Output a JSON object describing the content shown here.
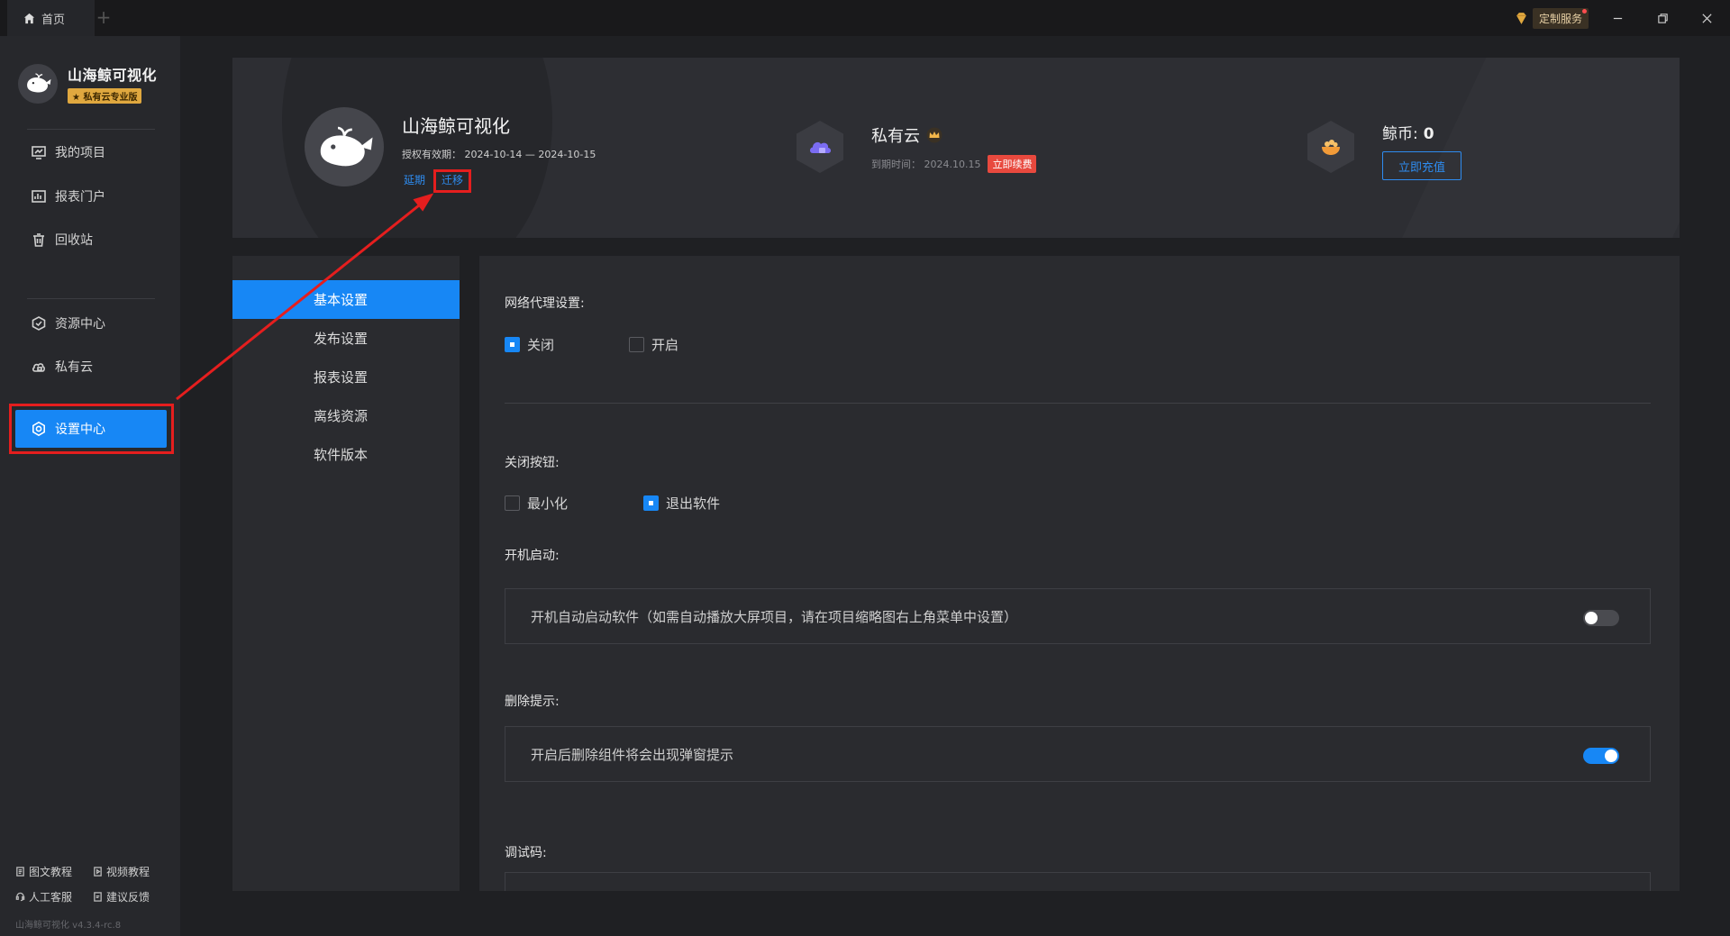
{
  "titlebar": {
    "home_tab": "首页",
    "add_tab": "+",
    "custom_service": "定制服务"
  },
  "sidebar": {
    "brand_name": "山海鲸可视化",
    "brand_badge": "★ 私有云专业版",
    "nav": [
      {
        "label": "我的项目",
        "icon": "project-icon"
      },
      {
        "label": "报表门户",
        "icon": "report-portal-icon"
      },
      {
        "label": "回收站",
        "icon": "trash-icon"
      },
      {
        "label": "资源中心",
        "icon": "resource-icon"
      },
      {
        "label": "私有云",
        "icon": "cloud-icon"
      },
      {
        "label": "设置中心",
        "icon": "gear-icon",
        "active": true
      }
    ],
    "help": [
      "图文教程",
      "视频教程",
      "人工客服",
      "建议反馈"
    ],
    "version": "山海鲸可视化 v4.3.4-rc.8"
  },
  "profile": {
    "name": "山海鲸可视化",
    "valid": "授权有效期： 2024-10-14 — 2024-10-15",
    "extend_link": "延期",
    "move_link": "迁移",
    "private_cloud_title": "私有云",
    "expire_text": "到期时间：  2024.10.15",
    "renew_button": "立即续费",
    "coin_label": "鲸币:",
    "coin_value": "0",
    "recharge_button": "立即充值"
  },
  "settings_menu": [
    "基本设置",
    "发布设置",
    "报表设置",
    "离线资源",
    "软件版本"
  ],
  "settings": {
    "proxy_label": "网络代理设置:",
    "proxy_off": "关闭",
    "proxy_on": "开启",
    "proxy_selected": "关闭",
    "close_label": "关闭按钮:",
    "close_minimize": "最小化",
    "close_exit": "退出软件",
    "close_selected": "退出软件",
    "startup_label": "开机启动:",
    "startup_desc": "开机自动启动软件（如需自动播放大屏项目，请在项目缩略图右上角菜单中设置）",
    "startup_enabled": false,
    "delete_label": "删除提示:",
    "delete_desc": "开启后删除组件将会出现弹窗提示",
    "delete_enabled": true,
    "debug_label": "调试码:"
  },
  "colors": {
    "accent": "#1787f5",
    "annotation": "#e51e1e",
    "badge_gold": "#e0a83f",
    "renew_red": "#e8493e"
  }
}
